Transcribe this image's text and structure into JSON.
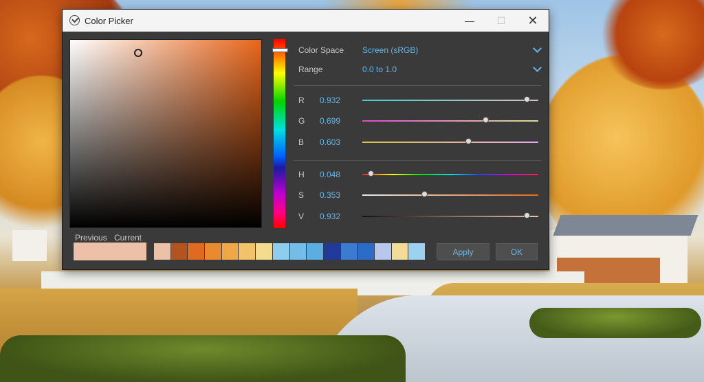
{
  "window": {
    "title": "Color Picker",
    "controls": {
      "minimize": "—",
      "maximize": "☐",
      "close": "✕"
    }
  },
  "picker": {
    "color_space": {
      "label": "Color Space",
      "value": "Screen (sRGB)"
    },
    "range": {
      "label": "Range",
      "value": "0.0 to 1.0"
    },
    "channels": [
      {
        "label": "R",
        "value": "0.932",
        "level": 0.932
      },
      {
        "label": "G",
        "value": "0.699",
        "level": 0.699
      },
      {
        "label": "B",
        "value": "0.603",
        "level": 0.603
      },
      {
        "label": "H",
        "value": "0.048",
        "level": 0.048
      },
      {
        "label": "S",
        "value": "0.353",
        "level": 0.353
      },
      {
        "label": "V",
        "value": "0.932",
        "level": 0.932
      }
    ],
    "saturation": 0.353,
    "value_brightness": 0.932,
    "hue": 0.048,
    "base_hue_color": "#e8651a"
  },
  "swatches": {
    "previous_label": "Previous",
    "current_label": "Current",
    "current_color": "#edc0a8",
    "palette": [
      "#edc0a8",
      "#b5531e",
      "#e06a20",
      "#ea8a2e",
      "#f0a847",
      "#f3c36a",
      "#f4dc8e",
      "#8fcdef",
      "#74bde8",
      "#5aaee2",
      "#213a9a",
      "#3d7bd0",
      "#2c6bc8",
      "#b8c8ec",
      "#f3dc98",
      "#9cd2f0"
    ]
  },
  "buttons": {
    "apply": "Apply",
    "ok": "OK"
  },
  "colors": {
    "accent": "#63b6ea",
    "panel_bg": "#3a3a3a"
  }
}
